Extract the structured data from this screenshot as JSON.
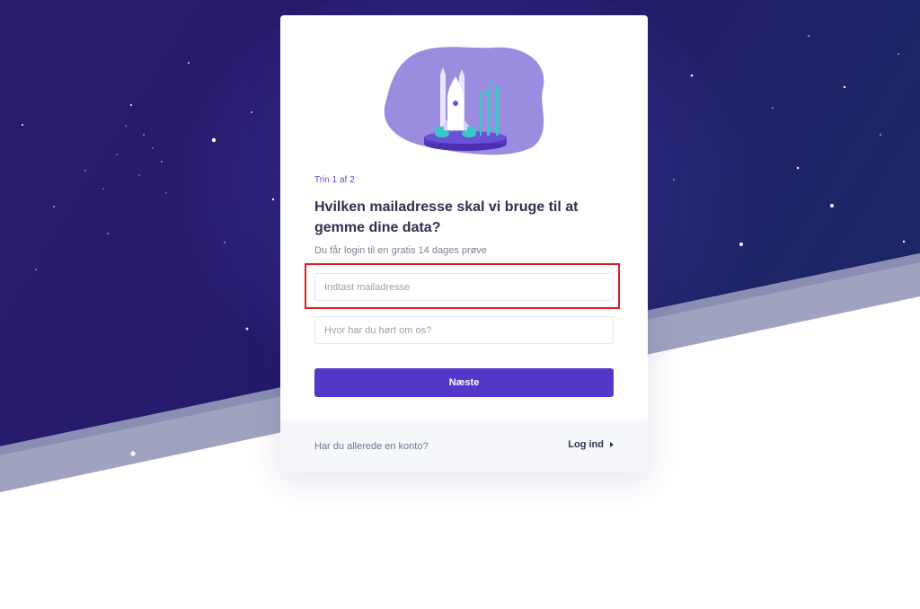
{
  "signup": {
    "step_label": "Trin 1 af 2",
    "heading": "Hvilken mailadresse skal vi bruge til at gemme dine data?",
    "subtitle": "Du får login til en gratis 14 dages prøve",
    "email_placeholder": "Indtast mailadresse",
    "email_value": "",
    "source_placeholder": "Hvor har du hørt om os?",
    "source_value": "",
    "next_label": "Næste"
  },
  "footer": {
    "question": "Har du allerede en konto?",
    "login_label": "Log ind",
    "login_icon": "caret-right-icon"
  },
  "colors": {
    "primary": "#5436c8",
    "highlight": "#e01d24",
    "heading": "#2e3050",
    "sky_dark": "#221866",
    "sky_light": "#3a2f97",
    "blob": "#9b8ce0"
  }
}
